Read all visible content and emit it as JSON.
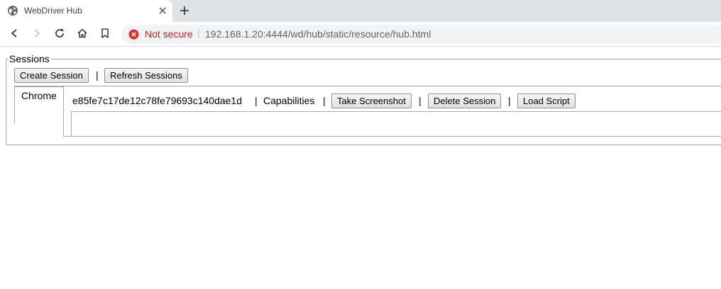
{
  "browser": {
    "tab": {
      "title": "WebDriver Hub"
    },
    "address_bar": {
      "security_label": "Not secure",
      "url": "192.168.1.20:4444/wd/hub/static/resource/hub.html"
    }
  },
  "page": {
    "sessions_legend": "Sessions",
    "create_session_label": "Create Session",
    "refresh_sessions_label": "Refresh Sessions",
    "pipe": "|",
    "browser_tab_label": "Chrome",
    "session": {
      "id": "e85fe7c17de12c78fe79693c140dae1d",
      "capabilities_label": "Capabilities",
      "take_screenshot_label": "Take Screenshot",
      "delete_session_label": "Delete Session",
      "load_script_label": "Load Script"
    }
  },
  "colors": {
    "tabstrip_bg": "#dee1e6",
    "omnibox_bg": "#f1f3f4",
    "insecure_red": "#c5221f",
    "border_gray": "#a9a9a9"
  }
}
